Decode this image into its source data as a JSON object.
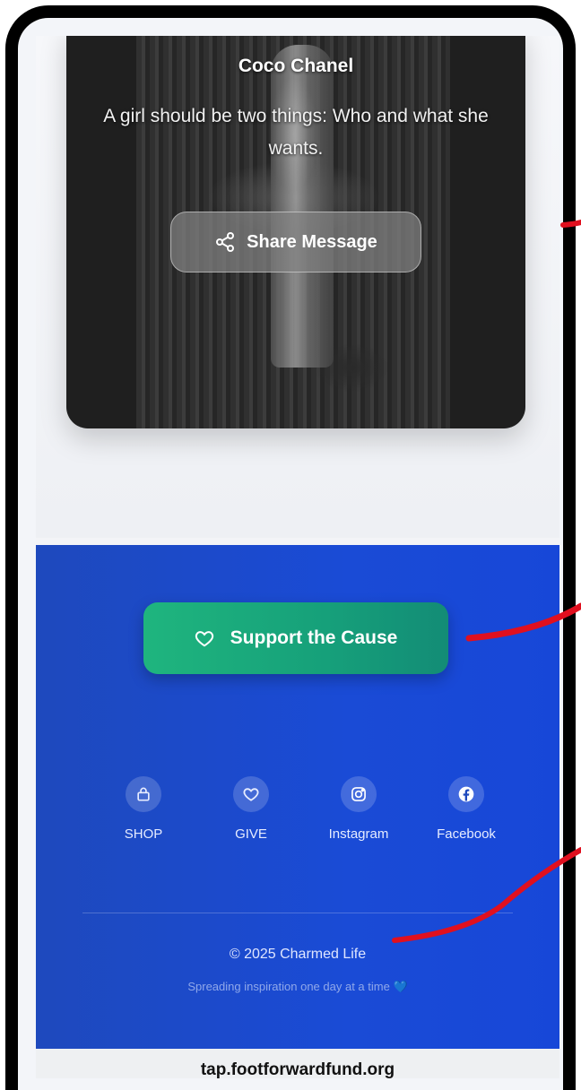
{
  "card": {
    "author": "Coco Chanel",
    "quote": "A girl should be two things: Who and what she wants.",
    "share_label": "Share Message"
  },
  "footer": {
    "support_label": "Support the Cause",
    "links": [
      {
        "label": "SHOP",
        "icon": "bag-icon"
      },
      {
        "label": "GIVE",
        "icon": "heart-icon"
      },
      {
        "label": "Instagram",
        "icon": "instagram-icon"
      },
      {
        "label": "Facebook",
        "icon": "facebook-icon"
      }
    ],
    "copyright": "© 2025 Charmed Life",
    "tagline": "Spreading inspiration one day at a time",
    "tagline_emoji": "💙"
  },
  "browser": {
    "url": "tap.footforwardfund.org"
  },
  "colors": {
    "footer_blue": "#1a4bd6",
    "support_green": "#1fb57e",
    "annotation_red": "#e0101f"
  }
}
